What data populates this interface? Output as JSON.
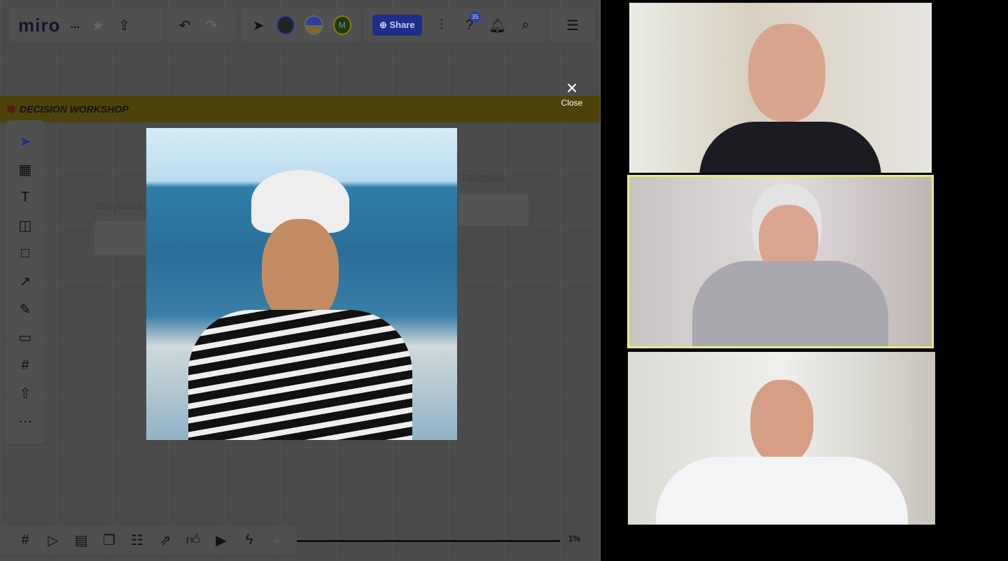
{
  "app": {
    "logo": "miro",
    "board_name": "...",
    "share_label": "Share",
    "notifications_count": "35",
    "avatar_initial": "M",
    "zoom_level": "1%"
  },
  "frame": {
    "title": "DECISION WORKSHOP"
  },
  "canvas": {
    "labels": [
      "Storyboard",
      "Feedback"
    ]
  },
  "modal": {
    "close_label": "Close",
    "close_icon": "×"
  },
  "colors": {
    "accent": "#1f2e8a",
    "frame": "#4d420a",
    "active_speaker_border": "#e6ee7a"
  },
  "video": {
    "participants": 3,
    "active_index": 1
  }
}
